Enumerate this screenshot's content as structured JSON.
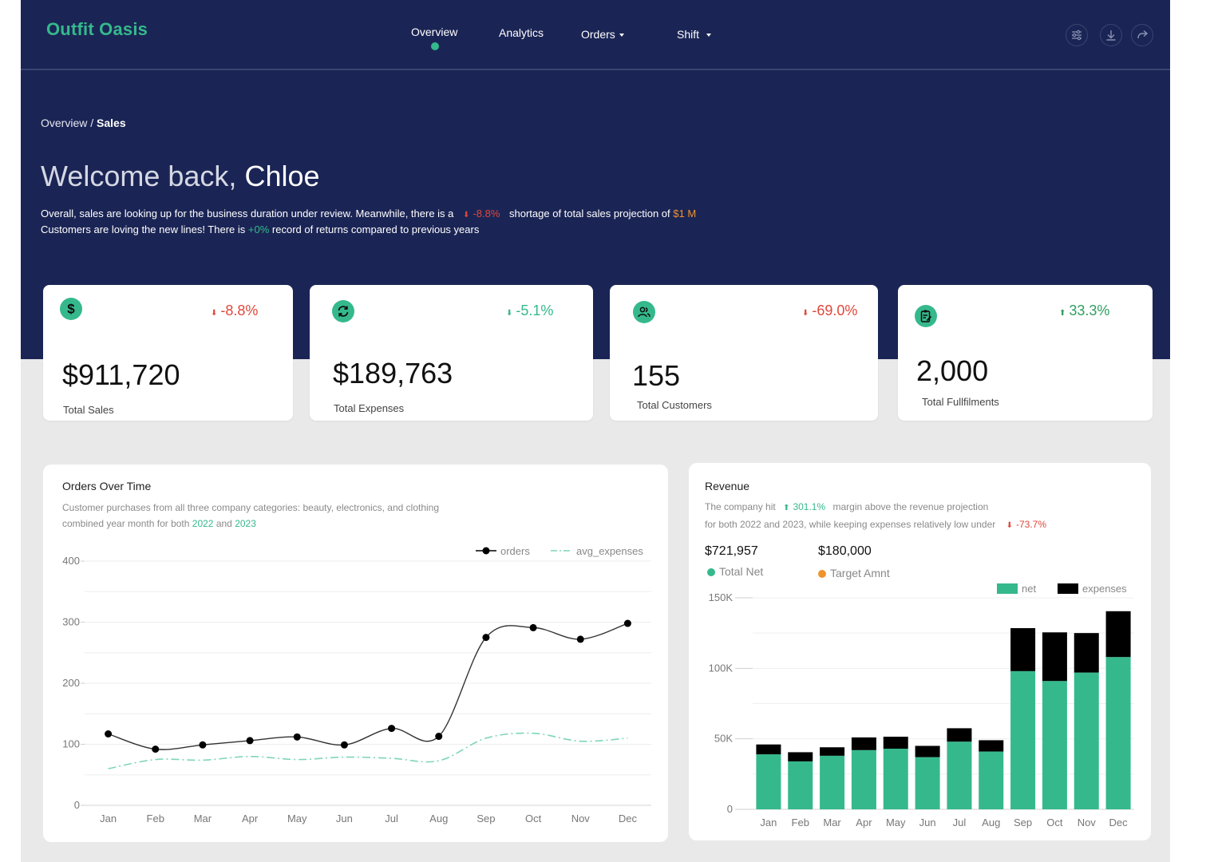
{
  "app": {
    "logo": "Outfit Oasis"
  },
  "nav": {
    "overview": "Overview",
    "analytics": "Analytics",
    "orders": "Orders",
    "shift": "Shift"
  },
  "breadcrumb": {
    "parent": "Overview /",
    "current": "Sales"
  },
  "welcome": {
    "greeting": "Welcome back,",
    "name": "Chloe"
  },
  "summary": {
    "line1_a": "Overall, sales are looking up for the business duration under review. Meanwhile, there is a",
    "line1_change": "-8.8%",
    "line1_b": "shortage of total sales projection of",
    "line1_amount": "$1 M",
    "line2_a": "Customers are loving the new lines! There is",
    "line2_change": "+0%",
    "line2_b": "record of returns compared to previous years"
  },
  "kpis": [
    {
      "change": "-8.8%",
      "value": "$911,720",
      "label": "Total Sales",
      "icon": "dollar-icon"
    },
    {
      "change": "-5.1%",
      "value": "$189,763",
      "label": "Total Expenses",
      "icon": "refresh-icon"
    },
    {
      "change": "-69.0%",
      "value": "155",
      "label": "Total Customers",
      "icon": "users-icon"
    },
    {
      "change": "33.3%",
      "value": "2,000",
      "label": "Total Fullfilments",
      "icon": "clipboard-icon"
    }
  ],
  "orders_card": {
    "title": "Orders Over Time",
    "desc_line1": "Customer purchases from all three company categories: beauty, electronics, and clothing",
    "desc_line2_a": "combined year month for both",
    "year1": "2022",
    "desc_and": "and",
    "year2": "2023"
  },
  "revenue_card": {
    "title": "Revenue",
    "desc_a": "The company hit",
    "desc_change1": "301.1%",
    "desc_b": "margin above the revenue projection",
    "desc_c": "for both 2022 and 2023, while keeping expenses relatively low under",
    "desc_change2": "-73.7%",
    "total_net_value": "$721,957",
    "total_net_label": "Total Net",
    "target_value": "$180,000",
    "target_label": "Target Amnt"
  },
  "colors": {
    "accent": "#35b98c",
    "navy": "#1b2555",
    "red": "#e0473b",
    "orange": "#f0932b"
  },
  "chart_data": [
    {
      "type": "line",
      "title": "Orders Over Time",
      "categories": [
        "Jan",
        "Feb",
        "Mar",
        "Apr",
        "May",
        "Jun",
        "Jul",
        "Aug",
        "Sep",
        "Oct",
        "Nov",
        "Dec"
      ],
      "series": [
        {
          "name": "orders",
          "values": [
            117,
            92,
            99,
            106,
            112,
            99,
            126,
            113,
            275,
            291,
            272,
            298
          ]
        },
        {
          "name": "avg_expenses",
          "values": [
            60,
            75,
            74,
            80,
            75,
            79,
            77,
            73,
            110,
            118,
            105,
            110
          ]
        }
      ],
      "ylim": [
        0,
        400
      ],
      "yticks": [
        0,
        100,
        200,
        300,
        400
      ],
      "legend": "top-right",
      "grid": true
    },
    {
      "type": "bar",
      "stacked": true,
      "title": "Revenue",
      "categories": [
        "Jan",
        "Feb",
        "Mar",
        "Apr",
        "May",
        "Jun",
        "Jul",
        "Aug",
        "Sep",
        "Oct",
        "Nov",
        "Dec"
      ],
      "series": [
        {
          "name": "net",
          "values": [
            39000,
            34000,
            38000,
            42000,
            43000,
            37000,
            48000,
            41000,
            98000,
            91000,
            97000,
            108000
          ]
        },
        {
          "name": "expenses",
          "values": [
            7000,
            6500,
            6000,
            9000,
            8500,
            8000,
            9500,
            8000,
            30500,
            34500,
            28000,
            32500
          ]
        }
      ],
      "ylim": [
        0,
        150000
      ],
      "yticks": [
        "0",
        "50K",
        "100K",
        "150K"
      ],
      "legend": "top-right",
      "grid": true
    }
  ]
}
